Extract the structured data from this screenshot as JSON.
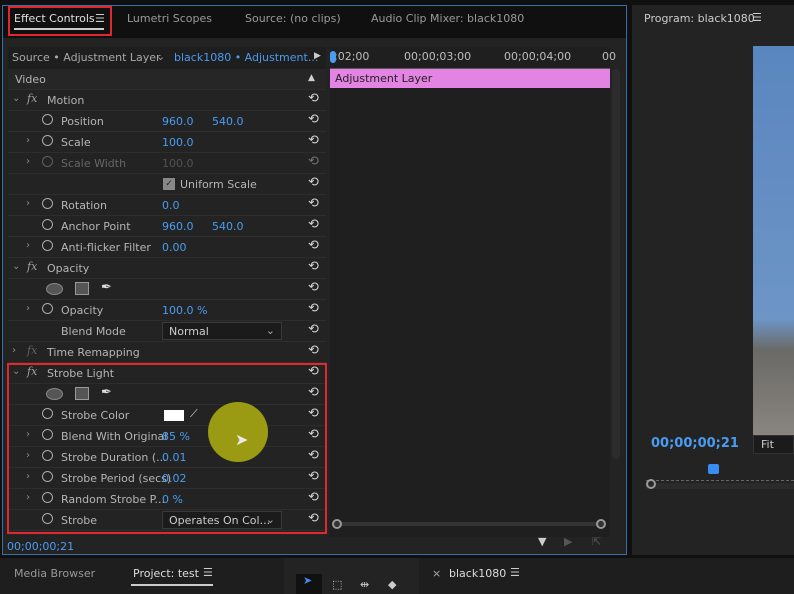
{
  "tabs": {
    "effect_controls": "Effect Controls",
    "lumetri": "Lumetri Scopes",
    "source": "Source: (no clips)",
    "audio_mixer": "Audio Clip Mixer: black1080",
    "program": "Program: black1080"
  },
  "source_bar": {
    "source": "Source • Adjustment Layer",
    "clip": "black1080 • Adjustment..."
  },
  "timeline": {
    "ticks": [
      ";02;00",
      "00;00;03;00",
      "00;00;04;00",
      "00"
    ],
    "clip_label": "Adjustment Layer"
  },
  "video_label": "Video",
  "rows": [
    {
      "kind": "effect",
      "label": "Motion",
      "twirl": "⌄",
      "fx": true
    },
    {
      "kind": "prop",
      "label": "Position",
      "v1": "960.0",
      "v2": "540.0"
    },
    {
      "kind": "prop",
      "label": "Scale",
      "v1": "100.0",
      "twirl": "›"
    },
    {
      "kind": "prop",
      "label": "Scale Width",
      "v1": "100.0",
      "twirl": "›",
      "disabled": true
    },
    {
      "kind": "check",
      "label": "Uniform Scale"
    },
    {
      "kind": "prop",
      "label": "Rotation",
      "v1": "0.0",
      "twirl": "›"
    },
    {
      "kind": "prop",
      "label": "Anchor Point",
      "v1": "960.0",
      "v2": "540.0"
    },
    {
      "kind": "prop",
      "label": "Anti-flicker Filter",
      "v1": "0.00",
      "twirl": "›"
    },
    {
      "kind": "effect",
      "label": "Opacity",
      "twirl": "⌄",
      "fx": true
    },
    {
      "kind": "masks"
    },
    {
      "kind": "prop",
      "label": "Opacity",
      "v1": "100.0 %",
      "twirl": "›"
    },
    {
      "kind": "select",
      "label": "Blend Mode",
      "value": "Normal",
      "nosw": true
    },
    {
      "kind": "effect",
      "label": "Time Remapping",
      "twirl": "›",
      "fx": true,
      "fxdim": true
    },
    {
      "kind": "effect",
      "label": "Strobe Light",
      "twirl": "⌄",
      "fx": true
    },
    {
      "kind": "masks"
    },
    {
      "kind": "color",
      "label": "Strobe Color",
      "color": "#ffffff"
    },
    {
      "kind": "prop",
      "label": "Blend With Original",
      "v1": "85 %",
      "twirl": "›"
    },
    {
      "kind": "prop",
      "label": "Strobe Duration (...",
      "v1": "0.01",
      "twirl": "›"
    },
    {
      "kind": "prop",
      "label": "Strobe Period (secs)",
      "v1": "0.02",
      "twirl": "›"
    },
    {
      "kind": "prop",
      "label": "Random Strobe P...",
      "v1": "0 %",
      "twirl": "›"
    },
    {
      "kind": "select",
      "label": "Strobe",
      "value": "Operates On Col..."
    }
  ],
  "timecode": "00;00;00;21",
  "program": {
    "timecode": "00;00;00;21",
    "fit": "Fit"
  },
  "bottom": {
    "media_browser": "Media Browser",
    "project": "Project: test",
    "sequence": "black1080"
  },
  "colors": {
    "accent": "#4a9cf0",
    "highlight": "#e0282e",
    "clip": "#e383e3"
  }
}
